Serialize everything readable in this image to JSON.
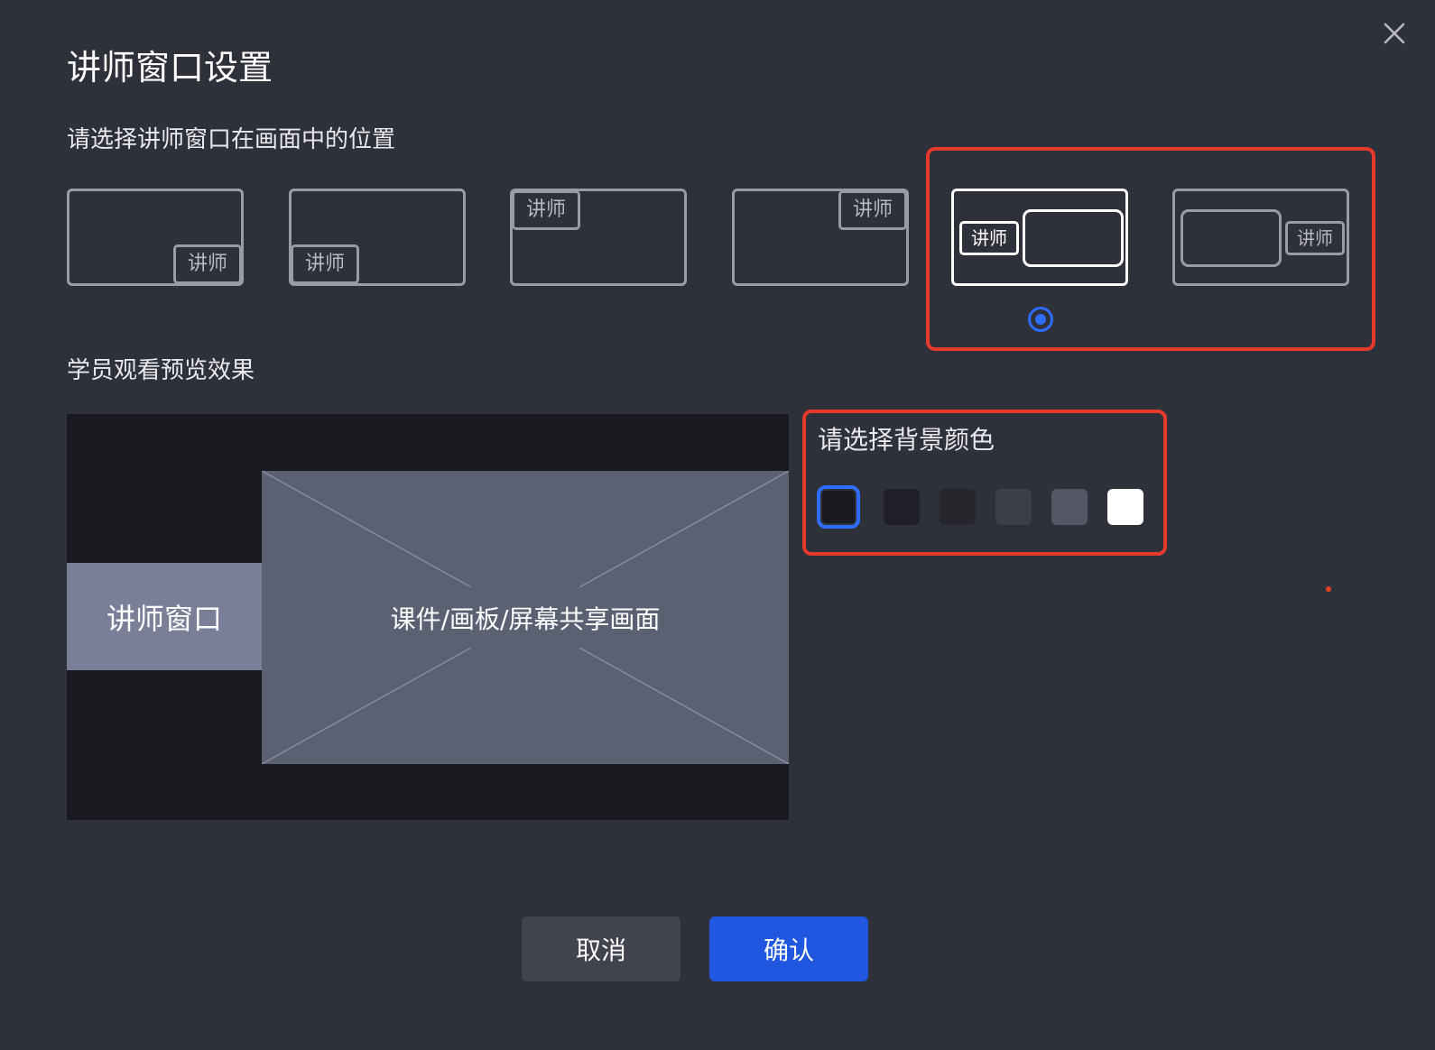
{
  "dialog": {
    "title": "讲师窗口设置",
    "close_icon": "close-icon"
  },
  "position_section": {
    "label": "请选择讲师窗口在画面中的位置",
    "options": [
      {
        "id": "bottom-right",
        "tag": "讲师",
        "selected": false
      },
      {
        "id": "bottom-left",
        "tag": "讲师",
        "selected": false
      },
      {
        "id": "top-left",
        "tag": "讲师",
        "selected": false
      },
      {
        "id": "top-right",
        "tag": "讲师",
        "selected": false
      },
      {
        "id": "side-left",
        "tag": "讲师",
        "selected": true
      },
      {
        "id": "side-right",
        "tag": "讲师",
        "selected": false
      }
    ]
  },
  "preview_section": {
    "label": "学员观看预览效果",
    "teacher_window_label": "讲师窗口",
    "courseware_label": "课件/画板/屏幕共享画面"
  },
  "background_section": {
    "label": "请选择背景颜色",
    "swatches": [
      {
        "color": "#191a1f",
        "selected": true
      },
      {
        "color": "#1f2027",
        "selected": false
      },
      {
        "color": "#25272d",
        "selected": false
      },
      {
        "color": "#3c3e48",
        "selected": false
      },
      {
        "color": "#545665",
        "selected": false
      },
      {
        "color": "#ffffff",
        "selected": false
      }
    ]
  },
  "footer": {
    "cancel_label": "取消",
    "confirm_label": "确认"
  },
  "colors": {
    "accent": "#1f57e0",
    "highlight": "#e53a2b",
    "dialog_bg": "#2f313a"
  }
}
